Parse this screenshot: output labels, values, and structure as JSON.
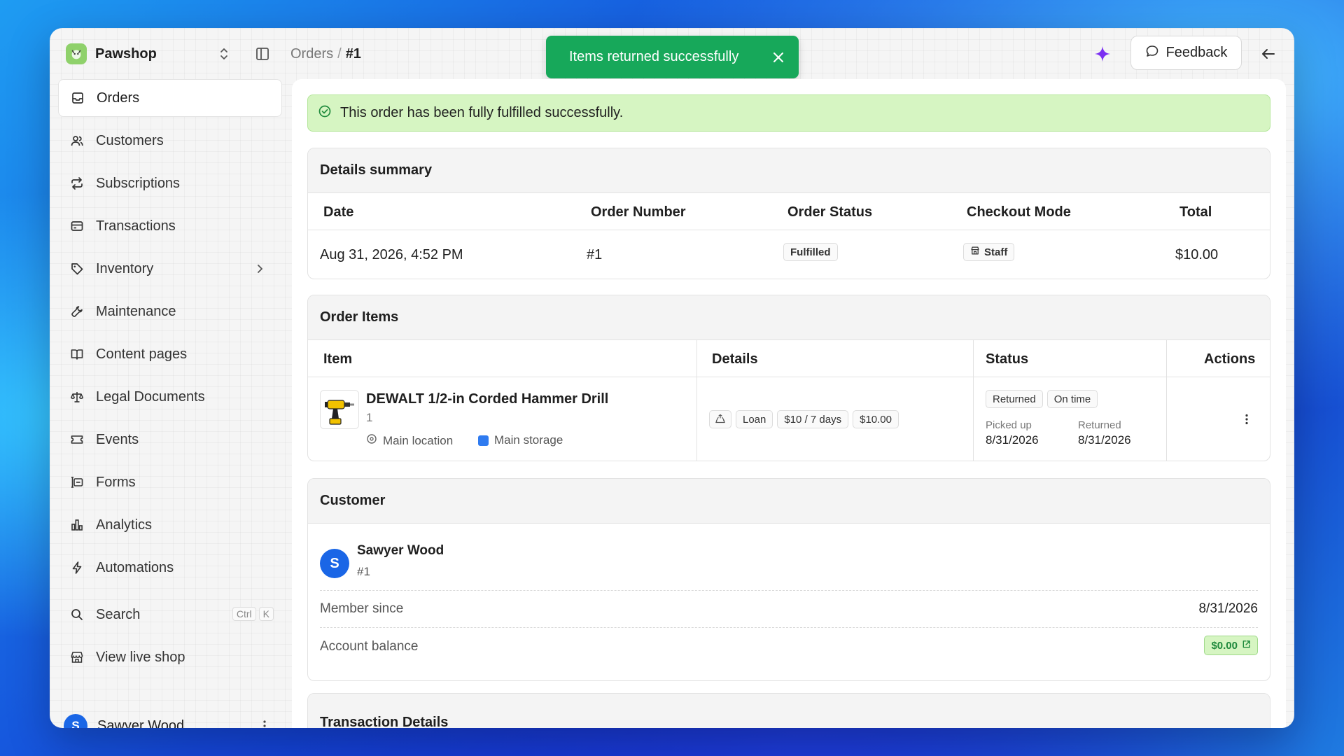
{
  "app": {
    "name": "Pawshop"
  },
  "breadcrumb": {
    "parent": "Orders",
    "separator": "/",
    "current": "#1"
  },
  "toast": {
    "message": "Items returned successfully"
  },
  "header": {
    "feedback_label": "Feedback"
  },
  "sidebar": {
    "items": [
      {
        "label": "Orders",
        "icon": "inbox-icon"
      },
      {
        "label": "Customers",
        "icon": "users-icon"
      },
      {
        "label": "Subscriptions",
        "icon": "repeat-icon"
      },
      {
        "label": "Transactions",
        "icon": "wallet-icon"
      },
      {
        "label": "Inventory",
        "icon": "tag-icon"
      },
      {
        "label": "Maintenance",
        "icon": "wrench-icon"
      },
      {
        "label": "Content pages",
        "icon": "book-icon"
      },
      {
        "label": "Legal Documents",
        "icon": "scale-icon"
      },
      {
        "label": "Events",
        "icon": "ticket-icon"
      },
      {
        "label": "Forms",
        "icon": "form-icon"
      },
      {
        "label": "Analytics",
        "icon": "bar-chart-icon"
      },
      {
        "label": "Automations",
        "icon": "bolt-icon"
      }
    ],
    "search": {
      "label": "Search",
      "kbd1": "Ctrl",
      "kbd2": "K"
    },
    "live_shop": "View live shop",
    "user": {
      "name": "Sawyer Wood",
      "initial": "S"
    }
  },
  "alert": {
    "message": "This order has been fully fulfilled successfully."
  },
  "summary": {
    "title": "Details summary",
    "headers": {
      "date": "Date",
      "order_number": "Order Number",
      "order_status": "Order Status",
      "checkout_mode": "Checkout Mode",
      "total": "Total"
    },
    "row": {
      "date": "Aug 31, 2026, 4:52 PM",
      "order_number": "#1",
      "order_status": "Fulfilled",
      "checkout_mode": "Staff",
      "total": "$10.00"
    }
  },
  "order_items": {
    "title": "Order Items",
    "headers": {
      "item": "Item",
      "details": "Details",
      "status": "Status",
      "actions": "Actions"
    },
    "row": {
      "name": "DEWALT 1/2-in Corded Hammer Drill",
      "quantity": "1",
      "location": "Main location",
      "storage": "Main storage",
      "type": "Loan",
      "rate": "$10 / 7 days",
      "price": "$10.00",
      "status": "Returned",
      "timeliness": "On time",
      "picked_up_label": "Picked up",
      "picked_up_date": "8/31/2026",
      "returned_label": "Returned",
      "returned_date": "8/31/2026"
    }
  },
  "customer": {
    "title": "Customer",
    "name": "Sawyer Wood",
    "initial": "S",
    "id": "#1",
    "member_since_label": "Member since",
    "member_since": "8/31/2026",
    "balance_label": "Account balance",
    "balance": "$0.00"
  },
  "transaction_details": {
    "title": "Transaction Details"
  },
  "colors": {
    "toast": "#17a85a",
    "alert_bg": "#d6f5c2",
    "avatar": "#1a66e6",
    "sparkle": "#7b2ff2"
  }
}
